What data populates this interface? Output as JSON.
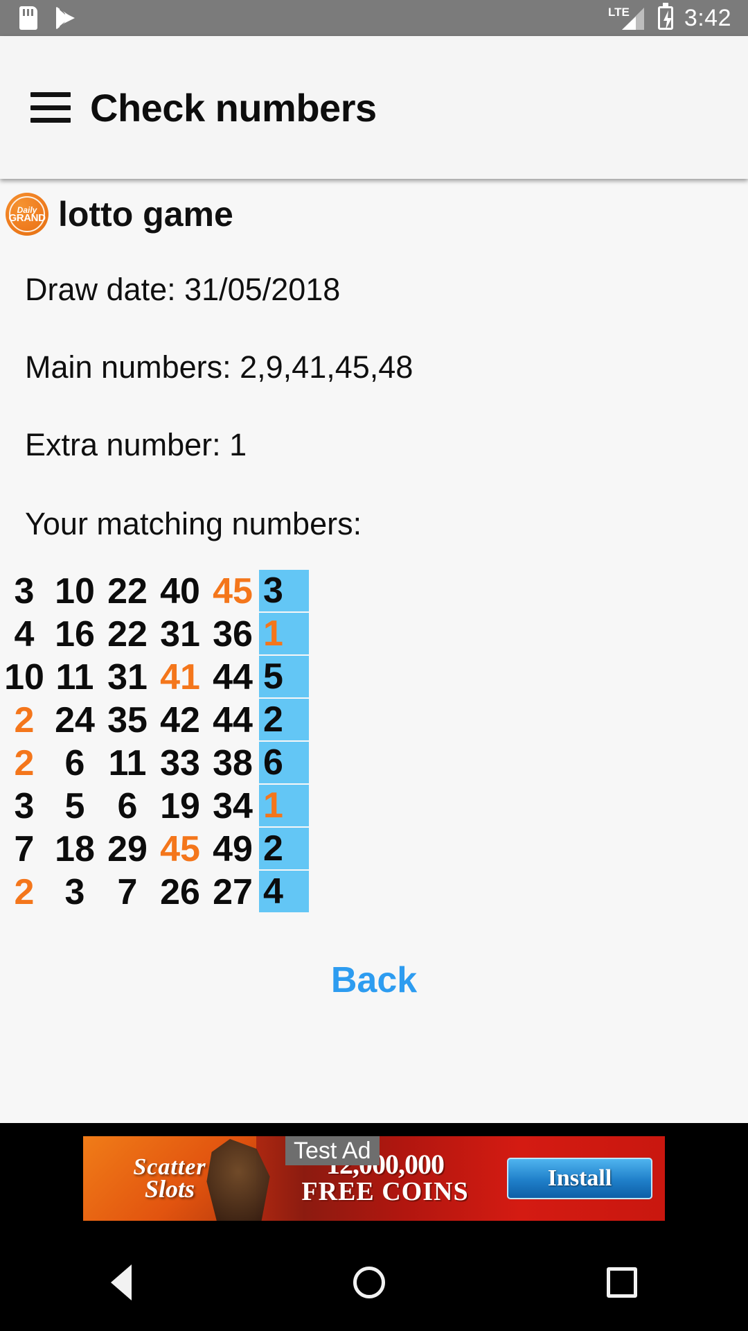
{
  "status_bar": {
    "icons_left": [
      "sd-card-icon",
      "google-play-icon"
    ],
    "network": "LTE",
    "battery": "charging",
    "time": "3:42"
  },
  "app_bar": {
    "menu_icon": "hamburger-menu-icon",
    "title": "Check numbers"
  },
  "game": {
    "logo_line1": "Daily",
    "logo_line2": "GRAND",
    "title": "lotto game"
  },
  "details": {
    "draw_date": "Draw date: 31/05/2018",
    "main_numbers": "Main numbers: 2,9,41,45,48",
    "extra_number": "Extra number: 1",
    "matching_label": "Your matching numbers:"
  },
  "colors": {
    "match_orange": "#f4761b",
    "extra_cell_blue": "#63c6f5",
    "link_blue": "#2d9cf0",
    "status_bar_gray": "#7b7b7b"
  },
  "matching_rows": [
    {
      "nums": [
        "3",
        "10",
        "22",
        "40",
        "45"
      ],
      "hits": [
        false,
        false,
        false,
        false,
        true
      ],
      "extra": "3",
      "extra_hit": false
    },
    {
      "nums": [
        "4",
        "16",
        "22",
        "31",
        "36"
      ],
      "hits": [
        false,
        false,
        false,
        false,
        false
      ],
      "extra": "1",
      "extra_hit": true
    },
    {
      "nums": [
        "10",
        "11",
        "31",
        "41",
        "44"
      ],
      "hits": [
        false,
        false,
        false,
        true,
        false
      ],
      "extra": "5",
      "extra_hit": false
    },
    {
      "nums": [
        "2",
        "24",
        "35",
        "42",
        "44"
      ],
      "hits": [
        true,
        false,
        false,
        false,
        false
      ],
      "extra": "2",
      "extra_hit": false
    },
    {
      "nums": [
        "2",
        "6",
        "11",
        "33",
        "38"
      ],
      "hits": [
        true,
        false,
        false,
        false,
        false
      ],
      "extra": "6",
      "extra_hit": false
    },
    {
      "nums": [
        "3",
        "5",
        "6",
        "19",
        "34"
      ],
      "hits": [
        false,
        false,
        false,
        false,
        false
      ],
      "extra": "1",
      "extra_hit": true
    },
    {
      "nums": [
        "7",
        "18",
        "29",
        "45",
        "49"
      ],
      "hits": [
        false,
        false,
        false,
        true,
        false
      ],
      "extra": "2",
      "extra_hit": false
    },
    {
      "nums": [
        "2",
        "3",
        "7",
        "26",
        "27"
      ],
      "hits": [
        true,
        false,
        false,
        false,
        false
      ],
      "extra": "4",
      "extra_hit": false
    }
  ],
  "actions": {
    "back_label": "Back"
  },
  "ad": {
    "test_label": "Test Ad",
    "brand_line1": "Scatter",
    "brand_line2": "Slots",
    "coins": "12,000,000",
    "free_coins": "FREE COINS",
    "install_label": "Install"
  },
  "nav_bar": {
    "back": "back-triangle-icon",
    "home": "home-circle-icon",
    "recents": "recents-square-icon"
  }
}
